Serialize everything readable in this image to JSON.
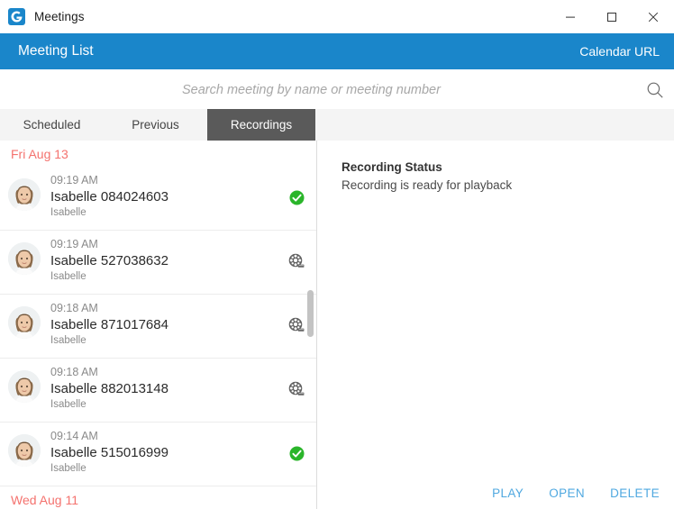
{
  "window": {
    "app_icon": "gotomeeting-g-icon",
    "title": "Meetings",
    "controls": {
      "minimize": "minimize-icon",
      "maximize": "maximize-icon",
      "close": "close-icon"
    }
  },
  "header": {
    "title": "Meeting List",
    "calendar_url_label": "Calendar URL",
    "accent_color": "#1a86ca"
  },
  "search": {
    "value": "",
    "placeholder": "Search meeting by name or meeting number",
    "icon": "search-icon"
  },
  "tabs": [
    {
      "label": "Scheduled",
      "active": false
    },
    {
      "label": "Previous",
      "active": false
    },
    {
      "label": "Recordings",
      "active": true
    }
  ],
  "list": {
    "groups": [
      {
        "date": "Fri Aug 13",
        "date_color": "#f4726e",
        "items": [
          {
            "time": "09:19 AM",
            "name": "Isabelle 084024603",
            "organizer": "Isabelle",
            "status_icon": "green-check-icon",
            "status_color": "#2ab52a"
          },
          {
            "time": "09:19 AM",
            "name": "Isabelle 527038632",
            "organizer": "Isabelle",
            "status_icon": "film-reel-icon",
            "status_color": "#5a5a5a"
          },
          {
            "time": "09:18 AM",
            "name": "Isabelle 871017684",
            "organizer": "Isabelle",
            "status_icon": "film-reel-icon",
            "status_color": "#5a5a5a"
          },
          {
            "time": "09:18 AM",
            "name": "Isabelle 882013148",
            "organizer": "Isabelle",
            "status_icon": "film-reel-icon",
            "status_color": "#5a5a5a"
          },
          {
            "time": "09:14 AM",
            "name": "Isabelle 515016999",
            "organizer": "Isabelle",
            "status_icon": "green-check-icon",
            "status_color": "#2ab52a"
          }
        ]
      },
      {
        "date": "Wed Aug 11",
        "date_color": "#f4726e",
        "items": []
      }
    ]
  },
  "detail": {
    "status_title": "Recording Status",
    "status_text": "Recording is ready for playback",
    "actions": [
      {
        "label": "PLAY"
      },
      {
        "label": "OPEN"
      },
      {
        "label": "DELETE"
      }
    ],
    "action_color": "#4fa8e0"
  }
}
